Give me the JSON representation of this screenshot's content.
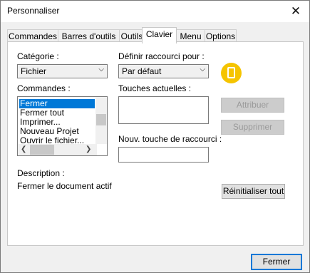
{
  "window": {
    "title": "Personnaliser",
    "close_glyph": "✕"
  },
  "tabs": [
    {
      "label": "Commandes"
    },
    {
      "label": "Barres d'outils"
    },
    {
      "label": "Outils"
    },
    {
      "label": "Clavier"
    },
    {
      "label": "Menu"
    },
    {
      "label": "Options"
    }
  ],
  "active_tab": "Clavier",
  "category": {
    "label": "Catégorie :",
    "value": "Fichier"
  },
  "shortcut_for": {
    "label": "Définir raccourci pour :",
    "value": "Par défaut"
  },
  "commands": {
    "label": "Commandes :",
    "items": [
      "Fermer",
      "Fermer tout",
      "Imprimer...",
      "Nouveau Projet",
      "Ouvrir le fichier..."
    ],
    "selected": "Fermer"
  },
  "current_keys": {
    "label": "Touches actuelles :"
  },
  "new_key": {
    "label": "Nouv. touche de raccourci :"
  },
  "buttons": {
    "assign": "Attribuer",
    "remove": "Supprimer",
    "reset_all": "Réinitialiser tout",
    "close": "Fermer"
  },
  "description": {
    "label": "Description :",
    "text": "Fermer le document actif"
  },
  "icons": {
    "app": "app-document-icon"
  }
}
